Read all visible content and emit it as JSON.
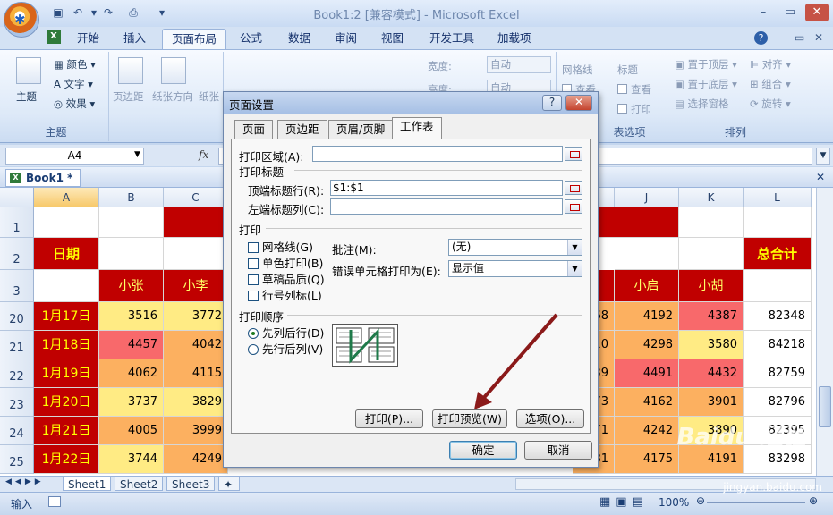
{
  "window": {
    "title": "Book1:2  [兼容模式] - Microsoft Excel",
    "minimize": "–",
    "restore": "▭",
    "close": "✕"
  },
  "ribbon": {
    "tabs": [
      "开始",
      "插入",
      "页面布局",
      "公式",
      "数据",
      "审阅",
      "视图",
      "开发工具",
      "加载项"
    ],
    "active_tab": "页面布局",
    "help": "?",
    "themes": {
      "main": "主题",
      "colors": "颜色",
      "fonts": "文字",
      "effects": "效果",
      "group": "主题"
    },
    "page_setup": {
      "margins": "页边距",
      "orientation": "纸张方向",
      "size": "纸张"
    },
    "scale": {
      "width": "宽度:",
      "height": "高度:",
      "width_val": "自动",
      "height_val": "自动"
    },
    "sheet_options": {
      "gridlines": "网格线",
      "headings": "标题",
      "view_a": "查看",
      "view_b": "查看",
      "print": "打印",
      "group": "表选项"
    },
    "arrange": {
      "bring_front": "置于顶层",
      "send_back": "置于底层",
      "selection_pane": "选择窗格",
      "align": "对齐",
      "group_btn": "组合",
      "rotate": "旋转",
      "group": "排列"
    }
  },
  "formula_bar": {
    "name_box": "A4",
    "fx": "fx"
  },
  "workbook": {
    "tab_title": "Book1 *"
  },
  "grid": {
    "columns": [
      "A",
      "B",
      "C",
      "J",
      "K",
      "L"
    ],
    "header_row1_label": "1",
    "row2": {
      "row": "2",
      "date_label": "日期",
      "total_label": "总合计"
    },
    "row3": {
      "row": "3",
      "names": [
        "小张",
        "小李",
        "小启",
        "小胡"
      ]
    },
    "rows": [
      {
        "row": "20",
        "date": "1月17日",
        "b": "3516",
        "c": "3772",
        "i": "68",
        "j": "4192",
        "k": "4387",
        "l": "82348"
      },
      {
        "row": "21",
        "date": "1月18日",
        "b": "4457",
        "c": "4042",
        "i": "10",
        "j": "4298",
        "k": "3580",
        "l": "84218"
      },
      {
        "row": "22",
        "date": "1月19日",
        "b": "4062",
        "c": "4115",
        "i": "39",
        "j": "4491",
        "k": "4432",
        "l": "82759"
      },
      {
        "row": "23",
        "date": "1月20日",
        "b": "3737",
        "c": "3829",
        "i": "73",
        "j": "4162",
        "k": "3901",
        "l": "82796"
      },
      {
        "row": "24",
        "date": "1月21日",
        "b": "4005",
        "c": "3999",
        "i": "71",
        "j": "4242",
        "k": "3890",
        "l": "82395"
      },
      {
        "row": "25",
        "date": "1月22日",
        "b": "3744",
        "c": "4249",
        "i": "81",
        "j": "4175",
        "k": "4191",
        "l": "83298"
      }
    ]
  },
  "sheets": [
    "Sheet1",
    "Sheet2",
    "Sheet3"
  ],
  "status": {
    "mode": "输入",
    "zoom": "100%"
  },
  "dialog": {
    "title": "页面设置",
    "help": "?",
    "close": "✕",
    "tabs": [
      "页面",
      "页边距",
      "页眉/页脚",
      "工作表"
    ],
    "active_tab": "工作表",
    "print_area_label": "打印区域(A):",
    "print_area_value": "",
    "print_titles_label": "打印标题",
    "rows_repeat_label": "顶端标题行(R):",
    "rows_repeat_value": "$1:$1",
    "cols_repeat_label": "左端标题列(C):",
    "cols_repeat_value": "",
    "print_label": "打印",
    "gridlines": "网格线(G)",
    "black_white": "单色打印(B)",
    "draft": "草稿品质(Q)",
    "row_col_headings": "行号列标(L)",
    "comments_label": "批注(M):",
    "comments_value": "(无)",
    "errors_label": "错误单元格打印为(E):",
    "errors_value": "显示值",
    "order_label": "打印顺序",
    "down_then_over": "先列后行(D)",
    "over_then_down": "先行后列(V)",
    "print_btn": "打印(P)...",
    "preview_btn": "打印预览(W)",
    "options_btn": "选项(O)...",
    "ok_btn": "确定",
    "cancel_btn": "取消"
  },
  "watermark": {
    "logo": "Baidu 经验",
    "url": "jingyan.baidu.com"
  },
  "colors": {
    "excel_red": "#c00000",
    "heat_high": "#f8696b",
    "heat_mid": "#fcb060",
    "heat_low": "#ffeb84",
    "arrow": "#8b1a1a"
  }
}
